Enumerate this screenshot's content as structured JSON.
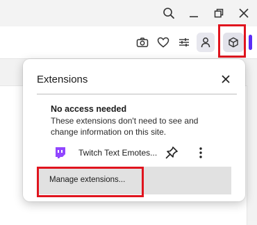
{
  "window_controls": {
    "search_icon": "search-icon",
    "minimize_icon": "minimize-icon",
    "restore_icon": "restore-icon",
    "close_icon": "close-icon"
  },
  "toolbar": {
    "icons": [
      "camera-icon",
      "heart-icon",
      "sliders-icon",
      "profile-icon",
      "extensions-cube-icon"
    ]
  },
  "popup": {
    "title": "Extensions",
    "section_title": "No access needed",
    "section_description": "These extensions don't need to see and change information on this site.",
    "extension_name": "Twitch Text Emotes...",
    "manage_label": "Manage extensions..."
  },
  "colors": {
    "highlight_box": "#e0141e",
    "accent": "#5b2cf5",
    "extension_icon": "#9146ff"
  }
}
